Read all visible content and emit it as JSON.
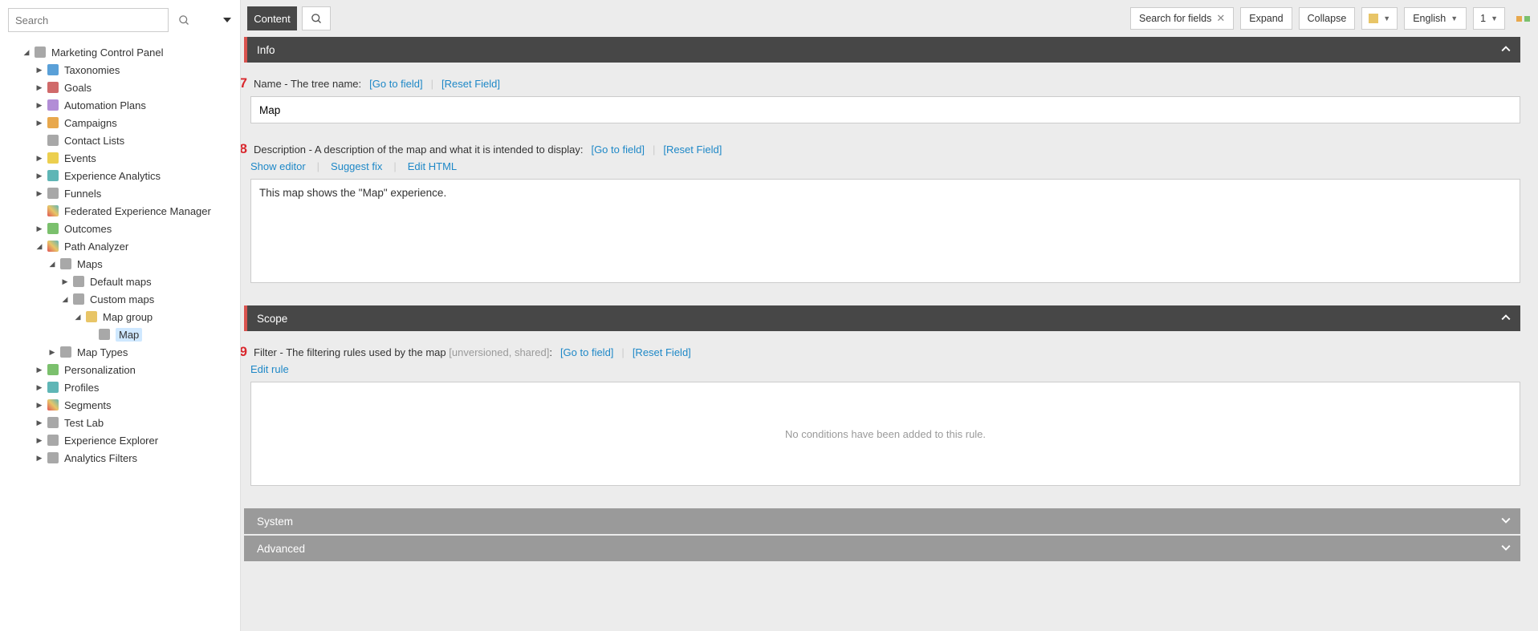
{
  "sidebar": {
    "search_placeholder": "Search",
    "tree": [
      {
        "label": "Marketing Control Panel",
        "level": 0,
        "expander": "down",
        "icon": "c-grey"
      },
      {
        "label": "Taxonomies",
        "level": 1,
        "expander": "right",
        "icon": "c-blue"
      },
      {
        "label": "Goals",
        "level": 1,
        "expander": "right",
        "icon": "c-red"
      },
      {
        "label": "Automation Plans",
        "level": 1,
        "expander": "right",
        "icon": "c-purple"
      },
      {
        "label": "Campaigns",
        "level": 1,
        "expander": "right",
        "icon": "c-orange"
      },
      {
        "label": "Contact Lists",
        "level": 1,
        "expander": "none",
        "icon": "c-grey"
      },
      {
        "label": "Events",
        "level": 1,
        "expander": "right",
        "icon": "c-yellow"
      },
      {
        "label": "Experience Analytics",
        "level": 1,
        "expander": "right",
        "icon": "c-teal"
      },
      {
        "label": "Funnels",
        "level": 1,
        "expander": "right",
        "icon": "c-grey"
      },
      {
        "label": "Federated Experience Manager",
        "level": 1,
        "expander": "none",
        "icon": "c-multi"
      },
      {
        "label": "Outcomes",
        "level": 1,
        "expander": "right",
        "icon": "c-green"
      },
      {
        "label": "Path Analyzer",
        "level": 1,
        "expander": "down",
        "icon": "c-multi"
      },
      {
        "label": "Maps",
        "level": 2,
        "expander": "down",
        "icon": "c-grey"
      },
      {
        "label": "Default maps",
        "level": 3,
        "expander": "right",
        "icon": "c-grey"
      },
      {
        "label": "Custom maps",
        "level": 3,
        "expander": "down",
        "icon": "c-grey"
      },
      {
        "label": "Map group",
        "level": 4,
        "expander": "down",
        "icon": "c-folder"
      },
      {
        "label": "Map",
        "level": 5,
        "expander": "none",
        "icon": "c-grey",
        "selected": true
      },
      {
        "label": "Map Types",
        "level": 2,
        "expander": "right",
        "icon": "c-grey"
      },
      {
        "label": "Personalization",
        "level": 1,
        "expander": "right",
        "icon": "c-green"
      },
      {
        "label": "Profiles",
        "level": 1,
        "expander": "right",
        "icon": "c-teal"
      },
      {
        "label": "Segments",
        "level": 1,
        "expander": "right",
        "icon": "c-multi"
      },
      {
        "label": "Test Lab",
        "level": 1,
        "expander": "right",
        "icon": "c-grey"
      },
      {
        "label": "Experience Explorer",
        "level": 1,
        "expander": "right",
        "icon": "c-grey"
      },
      {
        "label": "Analytics Filters",
        "level": 1,
        "expander": "right",
        "icon": "c-grey"
      }
    ]
  },
  "toolbar": {
    "tab_content": "Content",
    "search_fields_label": "Search for fields",
    "expand": "Expand",
    "collapse": "Collapse",
    "language": "English",
    "version": "1"
  },
  "sections": {
    "info": {
      "title": "Info",
      "name_marker": "7",
      "name_label": "Name - The tree name:",
      "go_to_field": "[Go to field]",
      "reset_field": "[Reset Field]",
      "name_value": "Map",
      "desc_marker": "8",
      "desc_label": "Description - A description of the map and what it is intended to display:",
      "show_editor": "Show editor",
      "suggest_fix": "Suggest fix",
      "edit_html": "Edit HTML",
      "desc_value": "This map shows the \"Map\" experience."
    },
    "scope": {
      "title": "Scope",
      "filter_marker": "9",
      "filter_label": "Filter - The filtering rules used by the map",
      "filter_hint": "[unversioned, shared]",
      "edit_rule": "Edit rule",
      "empty_rule": "No conditions have been added to this rule."
    },
    "system": {
      "title": "System"
    },
    "advanced": {
      "title": "Advanced"
    }
  }
}
